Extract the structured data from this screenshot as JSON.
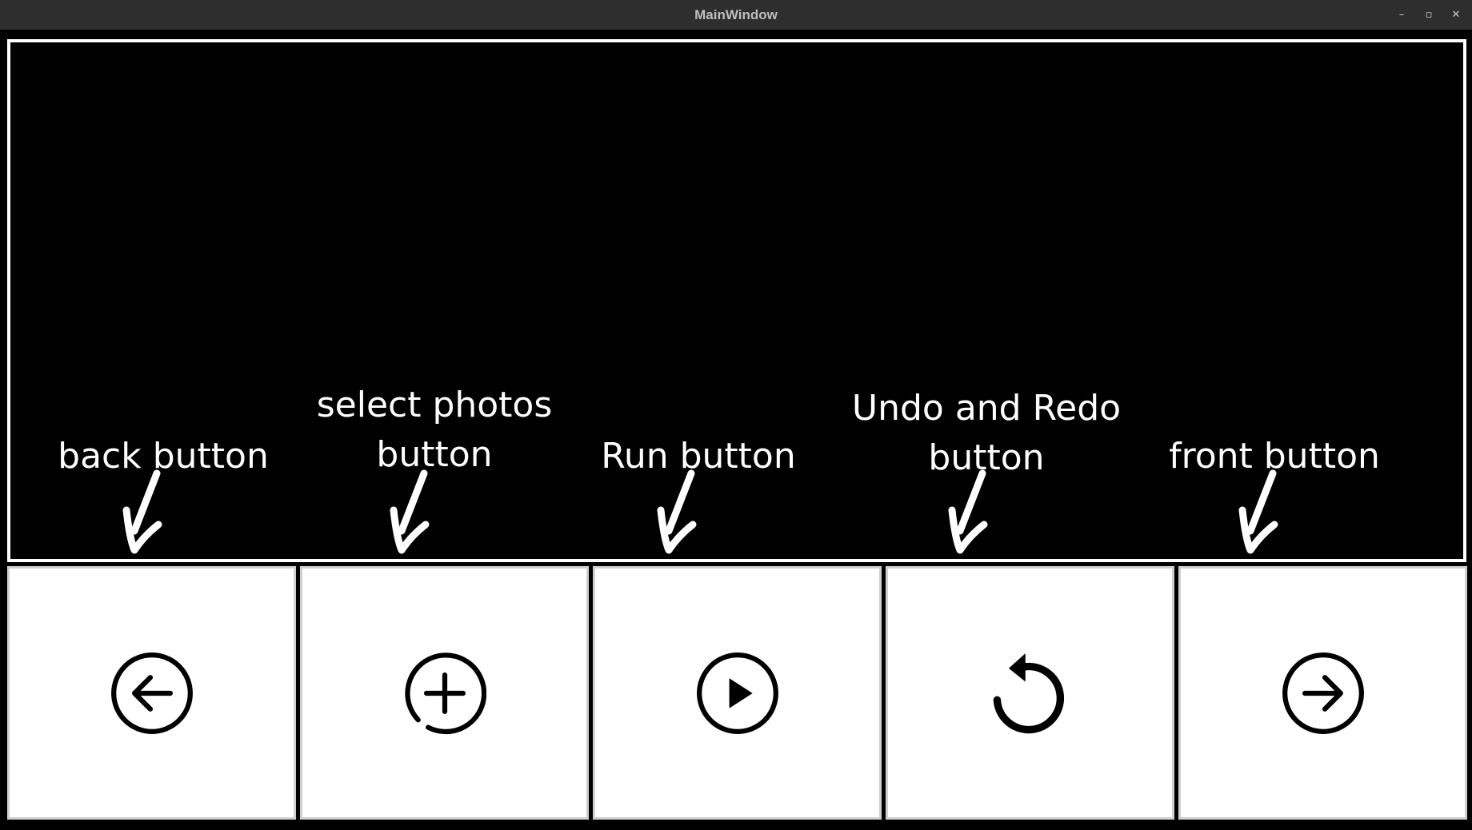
{
  "window": {
    "title": "MainWindow",
    "controls": {
      "minimize": "–",
      "restore": "▫",
      "close": "✕"
    }
  },
  "preview": {
    "labels": {
      "back": [
        "back button"
      ],
      "select": [
        "select photos",
        "button"
      ],
      "run": [
        "Run button"
      ],
      "undo": [
        "Undo and Redo",
        "button"
      ],
      "front": [
        "front button"
      ]
    }
  },
  "toolbar": {
    "buttons": [
      {
        "id": "back",
        "icon": "arrow-left-circle-icon"
      },
      {
        "id": "select",
        "icon": "plus-circle-icon"
      },
      {
        "id": "run",
        "icon": "play-circle-icon"
      },
      {
        "id": "undo",
        "icon": "rotate-ccw-icon"
      },
      {
        "id": "front",
        "icon": "arrow-right-circle-icon"
      }
    ]
  },
  "colors": {
    "background": "#000000",
    "titlebar": "#2e2e2e",
    "button_bg": "#ffffff",
    "icon": "#000000",
    "annotation": "#ffffff"
  }
}
